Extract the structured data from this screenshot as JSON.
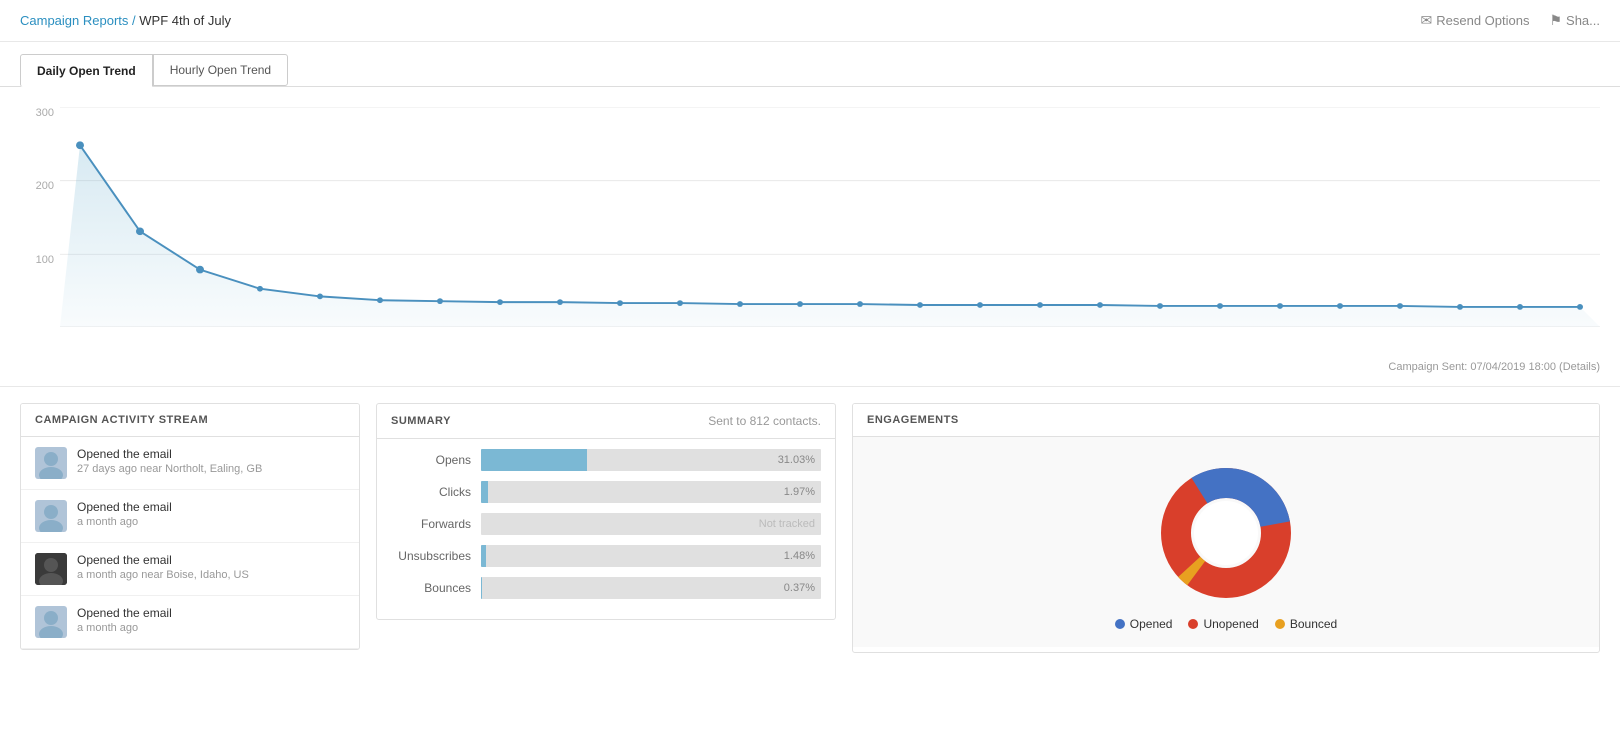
{
  "header": {
    "breadcrumb_link": "Campaign Reports",
    "breadcrumb_separator": "/",
    "page_title": "WPF 4th of July",
    "action_resend": "Resend Options",
    "action_share": "Sha..."
  },
  "tabs": {
    "tab1_label": "Daily Open Trend",
    "tab2_label": "Hourly Open Trend",
    "active": "tab1"
  },
  "chart": {
    "y_labels": [
      "300",
      "200",
      "100"
    ],
    "sent_info": "Campaign Sent: 07/04/2019 18:00 (Details)"
  },
  "activity": {
    "title": "CAMPAIGN ACTIVITY STREAM",
    "items": [
      {
        "action": "Opened the email",
        "time": "27 days ago near Northolt, Ealing, GB",
        "avatar_type": "light"
      },
      {
        "action": "Opened the email",
        "time": "a month ago",
        "avatar_type": "light"
      },
      {
        "action": "Opened the email",
        "time": "a month ago near Boise, Idaho, US",
        "avatar_type": "dark"
      },
      {
        "action": "Opened the email",
        "time": "a month ago",
        "avatar_type": "light"
      }
    ]
  },
  "summary": {
    "title": "SUMMARY",
    "contacts_info": "Sent to 812 contacts.",
    "rows": [
      {
        "label": "Opens",
        "pct": 31.03,
        "display": "31.03%",
        "bar_width": 31.03,
        "type": "value"
      },
      {
        "label": "Clicks",
        "pct": 1.97,
        "display": "1.97%",
        "bar_width": 1.97,
        "type": "value"
      },
      {
        "label": "Forwards",
        "pct": 0,
        "display": "Not tracked",
        "bar_width": 0,
        "type": "not_tracked"
      },
      {
        "label": "Unsubscribes",
        "pct": 1.48,
        "display": "1.48%",
        "bar_width": 1.48,
        "type": "value"
      },
      {
        "label": "Bounces",
        "pct": 0.37,
        "display": "0.37%",
        "bar_width": 0.37,
        "type": "value"
      }
    ]
  },
  "engagements": {
    "title": "ENGAGEMENTS",
    "legend": [
      {
        "label": "Opened",
        "color": "#4472c4"
      },
      {
        "label": "Unopened",
        "color": "#d93f2b"
      },
      {
        "label": "Bounced",
        "color": "#e8a020"
      }
    ],
    "donut": {
      "opened_pct": 31,
      "unopened_pct": 66,
      "bounced_pct": 3
    }
  }
}
